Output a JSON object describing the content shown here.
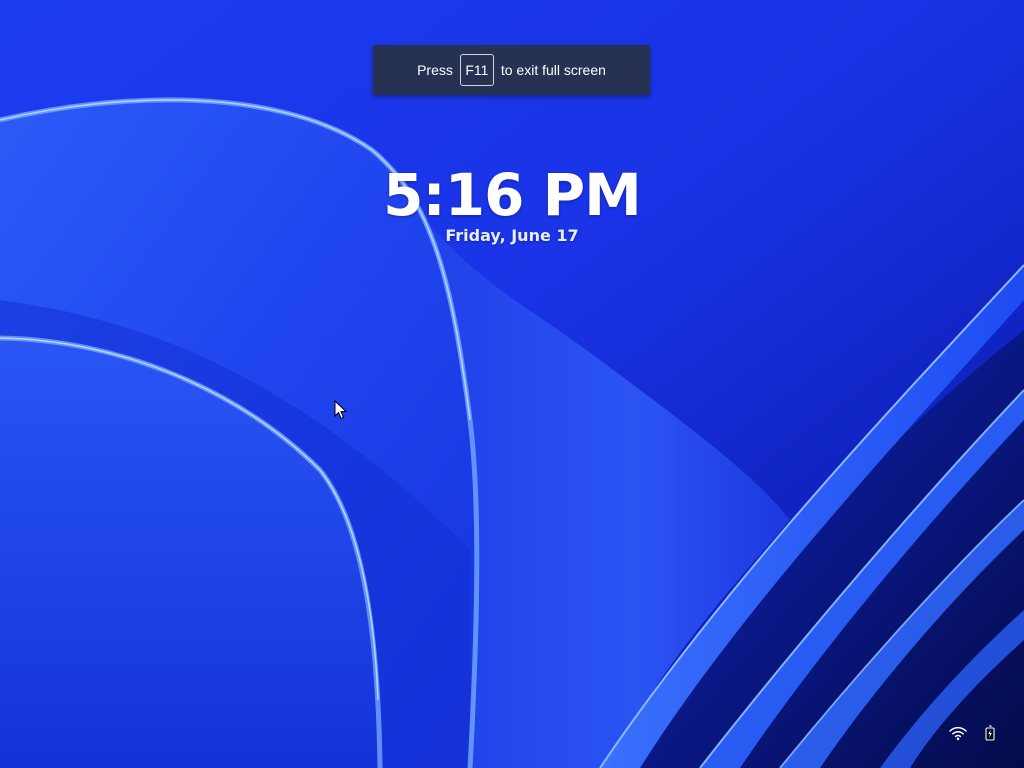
{
  "lock_screen": {
    "time": "5:16 PM",
    "date": "Friday, June 17"
  },
  "fullscreen_notice": {
    "prefix": "Press",
    "key": "F11",
    "suffix": "to exit full screen"
  },
  "tray_icons": [
    "wifi-icon",
    "battery-charging-icon"
  ],
  "colors": {
    "wallpaper_base": "#1d3ff2",
    "toast_background": "#273253",
    "text": "#ffffff"
  }
}
